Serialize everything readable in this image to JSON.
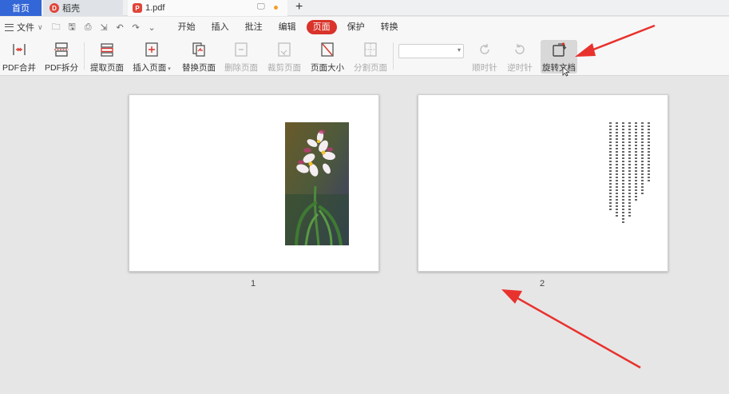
{
  "tabs": {
    "home": "首页",
    "daoke": "稻壳",
    "file": "1.pdf",
    "add": "+"
  },
  "menubar": {
    "file_menu": "文件",
    "items": [
      "开始",
      "插入",
      "批注",
      "编辑",
      "页面",
      "保护",
      "转换"
    ],
    "active": "页面"
  },
  "toolbar": {
    "pdf_merge": "PDF合并",
    "pdf_split": "PDF拆分",
    "extract_page": "提取页面",
    "insert_page": "插入页面",
    "replace_page": "替换页面",
    "delete_page": "删除页面",
    "crop_page": "裁剪页面",
    "page_size": "页面大小",
    "split_page": "分割页面",
    "rotate_cw": "顺时针",
    "rotate_ccw": "逆时针",
    "rotate_doc": "旋转文档"
  },
  "pages": {
    "page1_number": "1",
    "page2_number": "2"
  },
  "colors": {
    "accent": "#d9332b",
    "home_tab": "#3366d6",
    "annotation_arrow": "#e8322e"
  }
}
